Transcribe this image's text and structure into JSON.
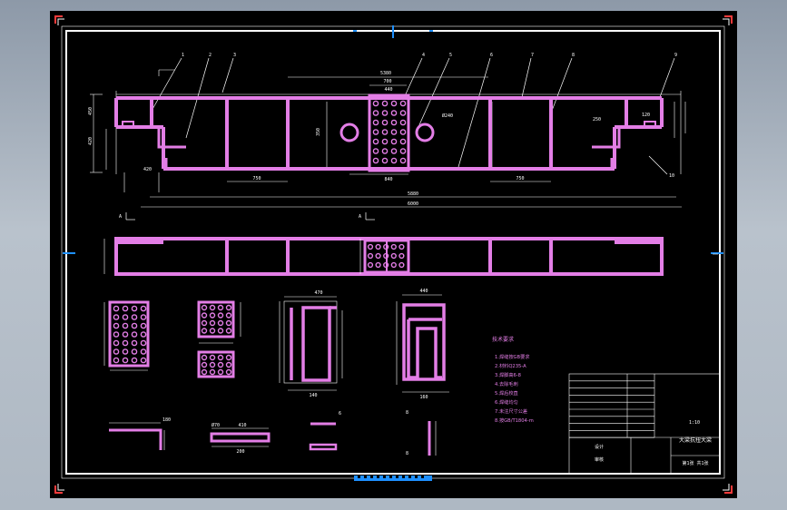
{
  "drawing": {
    "title_block": {
      "drawing_name": "大梁抗扭大梁",
      "scale": "1:10",
      "sheet": "第1张 共1张",
      "designer_label": "设计",
      "checker_label": "审核"
    },
    "main_dims": {
      "overall_length": "6000",
      "span": "5880",
      "upper_span": "5380",
      "middle_span": "700",
      "plate_width": "440",
      "bay_left": "750",
      "bay_right": "750",
      "bottom_left": "420",
      "center_bottom": "840",
      "hole_dia": "Ø240",
      "height_1": "450",
      "height_2": "420",
      "height_3": "350",
      "end_1": "250",
      "end_2": "120"
    },
    "leaders": [
      "1",
      "2",
      "3",
      "4",
      "5",
      "6",
      "7",
      "8",
      "9",
      "10"
    ],
    "section_marks": [
      "A",
      "A"
    ],
    "detail_dims": {
      "d1": "470",
      "d2": "440",
      "d3": "140",
      "d4": "160",
      "d5": "410",
      "d6": "200",
      "d7": "180",
      "d8": "470",
      "d9": "Ø70",
      "d10": "6",
      "d11": "8",
      "d12": "8"
    },
    "notes": {
      "heading": "技术要求",
      "lines": [
        "1.焊缝按GB要求",
        "2.材料Q235-A",
        "3.焊脚高6-8",
        "4.去除毛刺",
        "5.焊后校直",
        "6.焊缝均匀",
        "7.未注尺寸公差",
        "8.按GB/T1804-m"
      ]
    }
  }
}
